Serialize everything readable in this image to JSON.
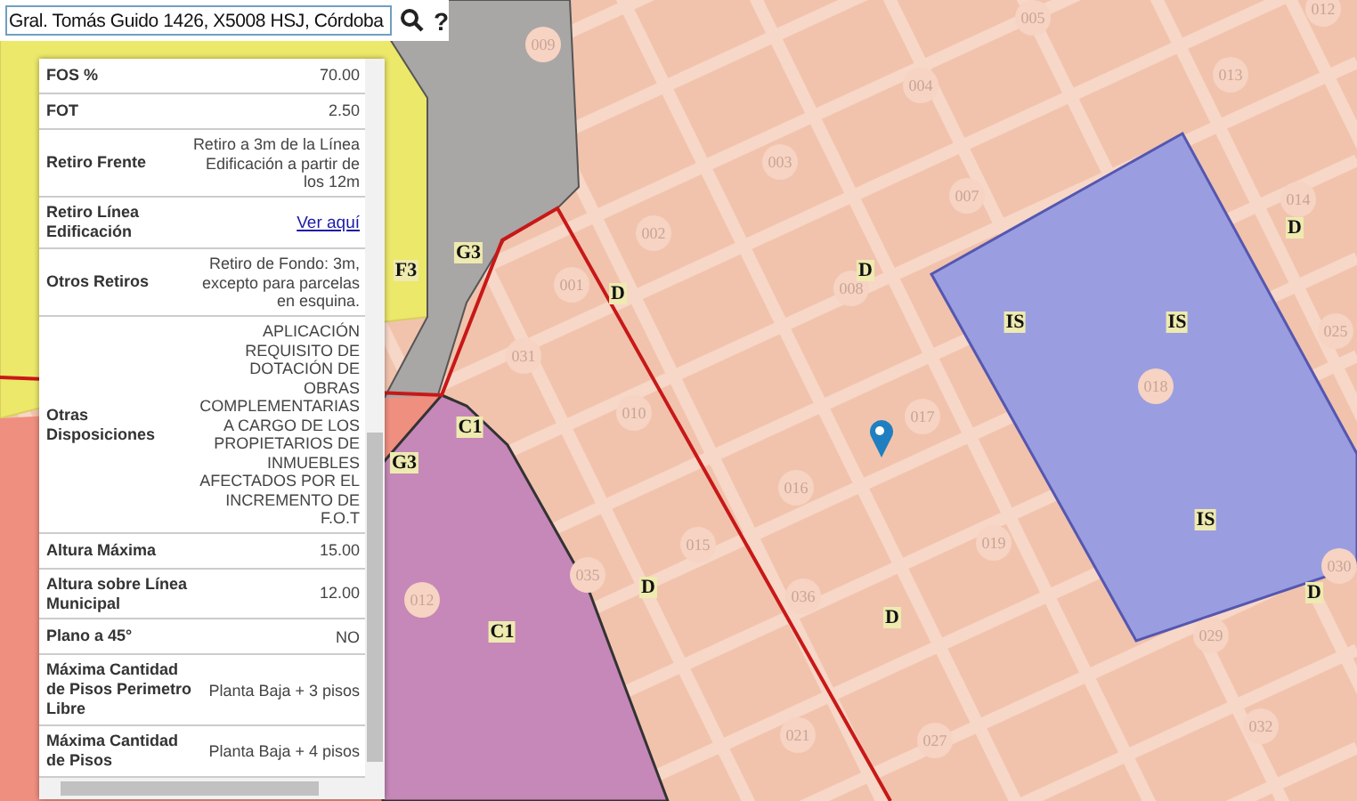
{
  "search": {
    "value": "Gral. Tomás Guido 1426, X5008 HSJ, Córdoba",
    "help": "?"
  },
  "info_table": {
    "rows": [
      {
        "label": "FOS %",
        "value": "70.00",
        "kind": "text"
      },
      {
        "label": "FOT",
        "value": "2.50",
        "kind": "text"
      },
      {
        "label": "Retiro Frente",
        "value": "Retiro a 3m de la Línea Edificación a partir de los 12m",
        "kind": "text"
      },
      {
        "label": "Retiro Línea Edificación",
        "value": "Ver aquí",
        "kind": "link"
      },
      {
        "label": "Otros Retiros",
        "value": "Retiro de Fondo: 3m, excepto para parcelas en esquina.",
        "kind": "text"
      },
      {
        "label": "Otras Disposiciones",
        "value": "APLICACIÓN REQUISITO DE DOTACIÓN DE OBRAS COMPLEMENTARIAS A CARGO DE LOS PROPIETARIOS DE INMUEBLES AFECTADOS POR EL INCREMENTO DE F.O.T",
        "kind": "text"
      },
      {
        "label": "Altura Máxima",
        "value": "15.00",
        "kind": "text"
      },
      {
        "label": "Altura sobre Línea Municipal",
        "value": "12.00",
        "kind": "text"
      },
      {
        "label": "Plano a 45°",
        "value": "NO",
        "kind": "text"
      },
      {
        "label": "Máxima Cantidad de Pisos Perimetro Libre",
        "value": "Planta Baja + 3 pisos",
        "kind": "text"
      },
      {
        "label": "Máxima Cantidad de Pisos",
        "value": "Planta Baja + 4 pisos",
        "kind": "text"
      }
    ]
  },
  "map": {
    "zone_labels": [
      "F3",
      "G3",
      "G3",
      "C1",
      "C1",
      "D",
      "D",
      "D",
      "D",
      "D",
      "D",
      "IS",
      "IS",
      "IS"
    ],
    "block_numbers": [
      "009",
      "005",
      "012",
      "004",
      "013",
      "003",
      "007",
      "014",
      "002",
      "008",
      "001",
      "031",
      "025",
      "018",
      "017",
      "010",
      "016",
      "015",
      "019",
      "035",
      "036",
      "030",
      "029",
      "021",
      "027",
      "032",
      "012"
    ]
  }
}
